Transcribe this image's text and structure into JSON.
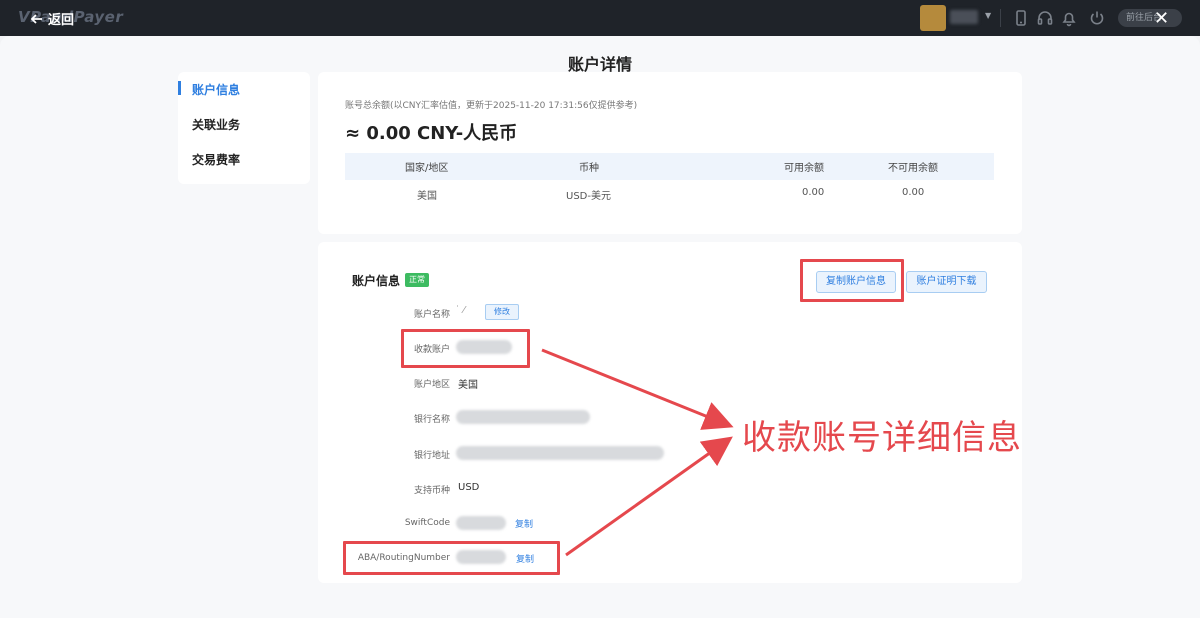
{
  "topbar": {
    "brand": "VPandPayer",
    "back_label": "返回",
    "pill_text": "前往后台",
    "close_glyph": "✕"
  },
  "page": {
    "title": "账户详情"
  },
  "nav": {
    "items": [
      {
        "label": "账户信息",
        "active": true
      },
      {
        "label": "关联业务",
        "active": false
      },
      {
        "label": "交易费率",
        "active": false
      }
    ]
  },
  "balance": {
    "note": "账号总余额(以CNY汇率估值，更新于2025-11-20 17:31:56仅提供参考)",
    "amount": "≈ 0.00 CNY-人民币",
    "table": {
      "headers": [
        "国家/地区",
        "币种",
        "可用余额",
        "不可用余额"
      ],
      "rows": [
        [
          "美国",
          "USD-美元",
          "0.00",
          "0.00"
        ]
      ]
    }
  },
  "account_info": {
    "title": "账户信息",
    "status": "正常",
    "copy_button": "复制账户信息",
    "download_button": "账户证明下载",
    "fields": {
      "name_label": "账户名称",
      "edit_label": "修改",
      "account_label": "收款账户",
      "region_label": "账户地区",
      "region_value": "美国",
      "bank_name_label": "银行名称",
      "bank_address_label": "银行地址",
      "currency_label": "支持币种",
      "currency_value": "USD",
      "swift_label": "SwiftCode",
      "aba_label": "ABA/RoutingNumber",
      "copy_link": "复制"
    }
  },
  "annotation": {
    "text": "收款账号详细信息",
    "color": "#e5484d"
  },
  "colors": {
    "accent": "#2f7fe0",
    "success": "#3dbb61",
    "highlight": "#e5484d",
    "topbar": "#1f2329"
  }
}
